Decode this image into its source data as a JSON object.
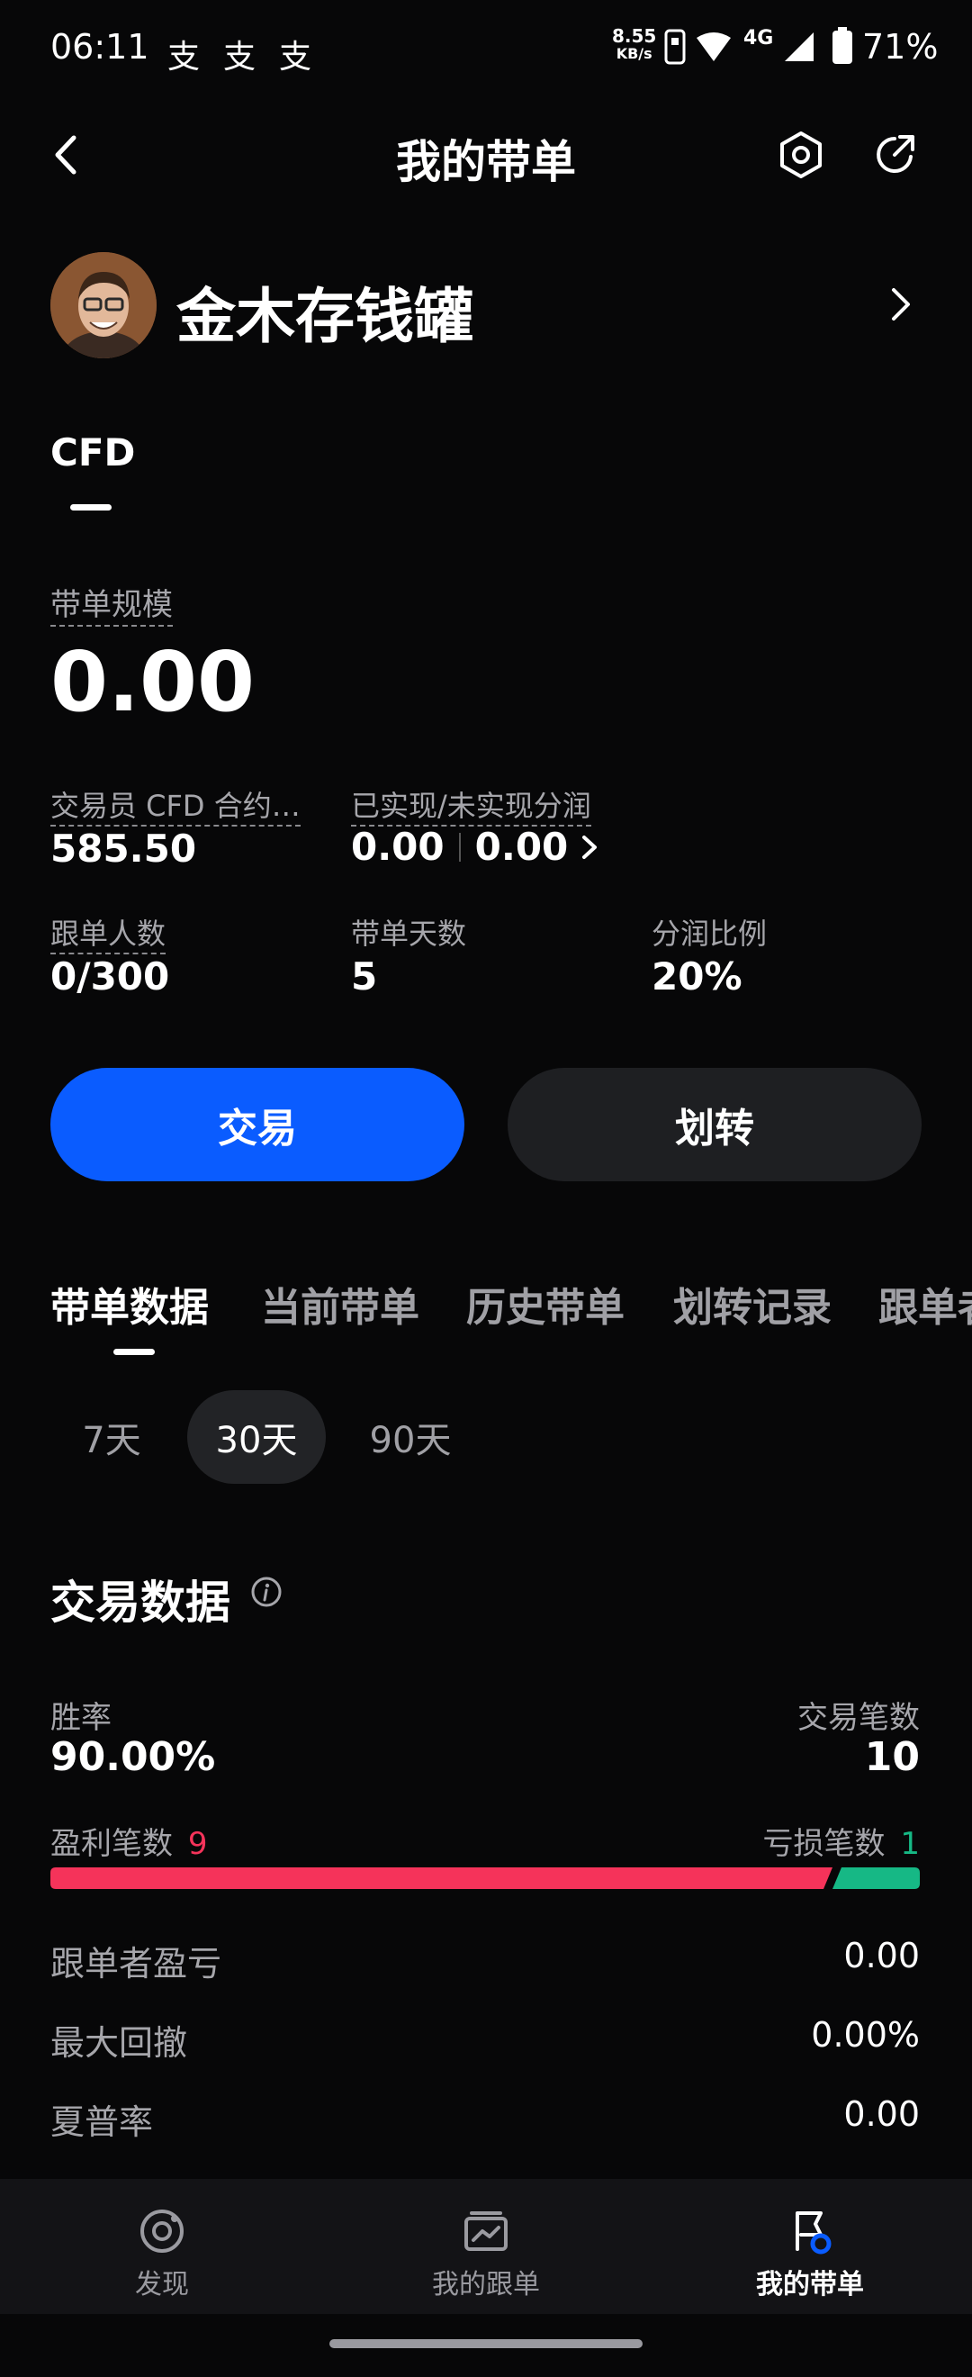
{
  "status_bar": {
    "time": "06:11",
    "alipay_icons": [
      "支",
      "支",
      "支"
    ],
    "net_speed_value": "8.55",
    "net_speed_unit": "KB/s",
    "network": "4G",
    "battery": "71%"
  },
  "header": {
    "title": "我的带单",
    "back_icon": "back-arrow-icon",
    "settings_icon": "hexagon-settings-icon",
    "share_icon": "share-icon"
  },
  "profile": {
    "name": "金木存钱罐"
  },
  "account_tab": {
    "label": "CFD"
  },
  "summary": {
    "scale_label": "带单规模",
    "scale_value": "0.00",
    "trader_contract_label": "交易员 CFD 合约…",
    "trader_contract_value": "585.50",
    "profit_share_label": "已实现/未实现分润",
    "realized_value": "0.00",
    "unrealized_value": "0.00",
    "followers_label": "跟单人数",
    "followers_value": "0/300",
    "days_label": "带单天数",
    "days_value": "5",
    "ratio_label": "分润比例",
    "ratio_value": "20%"
  },
  "actions": {
    "trade_label": "交易",
    "transfer_label": "划转"
  },
  "tabs": [
    {
      "label": "带单数据",
      "active": true
    },
    {
      "label": "当前带单",
      "active": false
    },
    {
      "label": "历史带单",
      "active": false
    },
    {
      "label": "划转记录",
      "active": false
    },
    {
      "label": "跟单者",
      "active": false
    }
  ],
  "periods": [
    {
      "label": "7天",
      "active": false
    },
    {
      "label": "30天",
      "active": true
    },
    {
      "label": "90天",
      "active": false
    }
  ],
  "trade_data": {
    "title": "交易数据",
    "win_rate_label": "胜率",
    "win_rate_value": "90.00%",
    "trade_count_label": "交易笔数",
    "trade_count_value": "10",
    "profit_count_label": "盈利笔数",
    "profit_count_value": "9",
    "loss_count_label": "亏损笔数",
    "loss_count_value": "1",
    "win_fraction": 0.9,
    "follower_pnl_label": "跟单者盈亏",
    "follower_pnl_value": "0.00",
    "max_drawdown_label": "最大回撤",
    "max_drawdown_value": "0.00%",
    "sharpe_label": "夏普率",
    "sharpe_value": "0.00"
  },
  "bottom_nav": [
    {
      "label": "发现",
      "active": false
    },
    {
      "label": "我的跟单",
      "active": false
    },
    {
      "label": "我的带单",
      "active": true
    }
  ],
  "colors": {
    "primary_blue": "#0a5cff",
    "profit_red": "#f5335a",
    "loss_green": "#16b885",
    "background": "#070708"
  }
}
